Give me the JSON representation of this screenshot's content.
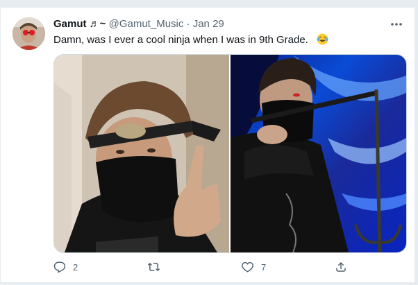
{
  "tweet": {
    "display_name": "Gamut ♬~",
    "handle": "@Gamut_Music",
    "separator": "·",
    "date": "Jan 29",
    "text": "Damn, was I ever a cool ninja when I was in 9th Grade.",
    "emoji": "face-with-tears-of-joy",
    "images": [
      "ninja-photo-headband",
      "ninja-photo-sai-blue-background"
    ],
    "actions": {
      "reply_count": "2",
      "retweet_count": "",
      "like_count": "7"
    }
  },
  "colors": {
    "accent_text": "#0f1419",
    "secondary_text": "#536471",
    "border": "#cfd9de",
    "page_bg": "#e6ecf0"
  }
}
